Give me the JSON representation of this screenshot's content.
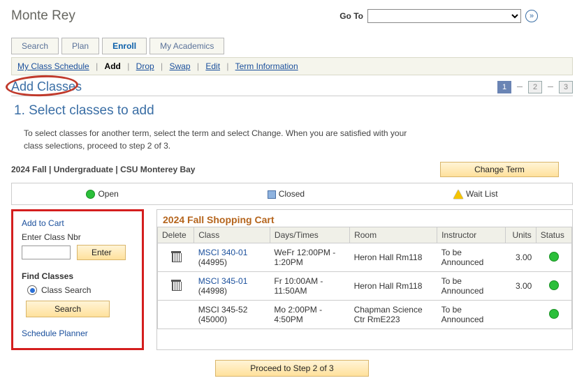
{
  "user_name": "Monte Rey",
  "goto_label": "Go To",
  "top_tabs": {
    "search": "Search",
    "plan": "Plan",
    "enroll": "Enroll",
    "academics": "My Academics"
  },
  "subnav": {
    "schedule": "My Class Schedule",
    "add": "Add",
    "drop": "Drop",
    "swap": "Swap",
    "edit": "Edit",
    "terminfo": "Term Information"
  },
  "page_title": "Add Classes",
  "steps": [
    "1",
    "2",
    "3"
  ],
  "section_heading": "1.  Select classes to add",
  "intro": "To select classes for another term, select the term and select Change.  When you are satisfied with your class selections, proceed to step 2 of 3.",
  "term_line": "2024 Fall | Undergraduate | CSU Monterey Bay",
  "change_term_btn": "Change Term",
  "legend": {
    "open": "Open",
    "closed": "Closed",
    "wait": "Wait List"
  },
  "cartbox": {
    "add_to_cart": "Add to Cart",
    "enter_nbr": "Enter Class Nbr",
    "enter_btn": "Enter",
    "find_classes": "Find Classes",
    "class_search": "Class Search",
    "search_btn": "Search",
    "planner": "Schedule Planner"
  },
  "cart_title": "2024 Fall Shopping Cart",
  "columns": {
    "delete": "Delete",
    "class": "Class",
    "daystimes": "Days/Times",
    "room": "Room",
    "instructor": "Instructor",
    "units": "Units",
    "status": "Status"
  },
  "rows": [
    {
      "class_link": "MSCI 340-01",
      "class_nbr": "(44995)",
      "daystimes": "WeFr 12:00PM - 1:20PM",
      "room": "Heron Hall Rm118",
      "instructor": "To be Announced",
      "units": "3.00",
      "status": "open",
      "deletable": true
    },
    {
      "class_link": "MSCI 345-01",
      "class_nbr": "(44998)",
      "daystimes": "Fr 10:00AM - 11:50AM",
      "room": "Heron Hall Rm118",
      "instructor": "To be Announced",
      "units": "3.00",
      "status": "open",
      "deletable": true
    },
    {
      "class_link": "MSCI 345-52",
      "class_nbr": "(45000)",
      "daystimes": "Mo 2:00PM - 4:50PM",
      "room": "Chapman Science Ctr RmE223",
      "instructor": "To be Announced",
      "units": "",
      "status": "open",
      "deletable": false
    }
  ],
  "proceed_btn": "Proceed to Step 2 of 3"
}
